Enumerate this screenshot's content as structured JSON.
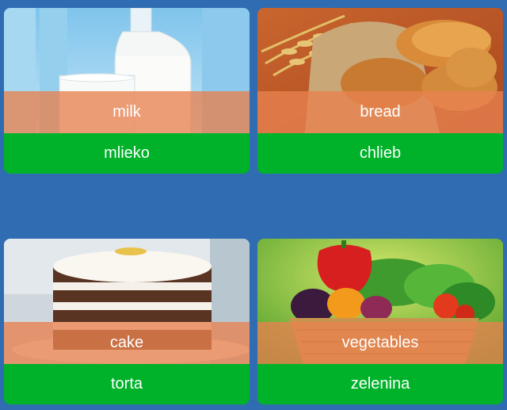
{
  "cards": [
    {
      "word": "milk",
      "translation": "mlieko",
      "image": "milk-bottle-and-glass"
    },
    {
      "word": "bread",
      "translation": "chlieb",
      "image": "bread-loaves-with-wheat"
    },
    {
      "word": "cake",
      "translation": "torta",
      "image": "layered-chocolate-cream-cake"
    },
    {
      "word": "vegetables",
      "translation": "zelenina",
      "image": "vegetable-basket"
    }
  ],
  "colors": {
    "background": "#2f6cb1",
    "word_band": "#e88250",
    "translation_band": "#00b22a",
    "text": "#ffffff"
  }
}
